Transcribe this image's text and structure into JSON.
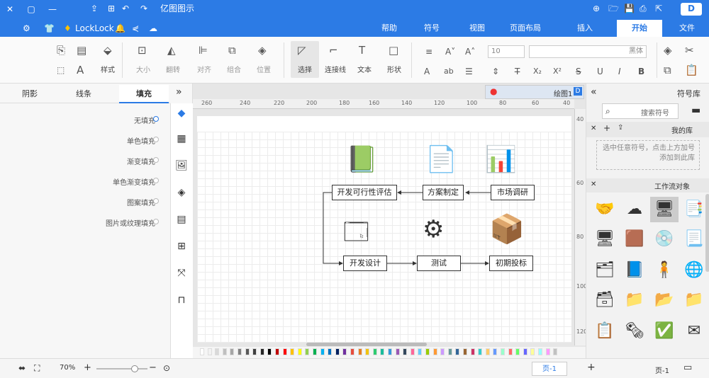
{
  "app": {
    "title": "亿图图示",
    "quick_access": [
      "LockLock",
      "◇"
    ],
    "tabs": [
      "文件",
      "开始",
      "插入",
      "页面布局",
      "视图",
      "符号",
      "帮助"
    ],
    "active_tab": "开始"
  },
  "ribbon": {
    "font_name": "黑体",
    "font_size": "10",
    "labels": {
      "select": "选择",
      "connector": "连接线",
      "text": "文本",
      "shape": "形状",
      "position": "位置",
      "group": "组合",
      "align": "对齐",
      "flip": "翻转",
      "size": "大小",
      "style": "样式"
    }
  },
  "left_panel": {
    "tabs": [
      "填充",
      "线条",
      "阴影"
    ],
    "active_tab": "填充",
    "fill_options": [
      "无填充",
      "单色填充",
      "渐变填充",
      "单色渐变填充",
      "图案填充",
      "图片或纹理填充"
    ],
    "selected_fill": "无填充"
  },
  "canvas": {
    "doc_tab": "绘图1",
    "ruler_ticks": [
      "260",
      "240",
      "220",
      "200",
      "180",
      "160",
      "140",
      "120",
      "100",
      "80",
      "60",
      "40"
    ],
    "vruler_ticks": [
      "40",
      "60",
      "80",
      "100",
      "120"
    ],
    "nodes": {
      "market_research": "市场调研",
      "plan": "方案制定",
      "feasibility": "开发可行性评估",
      "initial_bid": "初期投标",
      "test": "测试",
      "design": "开发设计"
    }
  },
  "library": {
    "title": "符号库",
    "search_placeholder": "搜索符号",
    "my_library": "我的库",
    "my_library_hint": "选中任意符号，点击上方加号添加到此库",
    "category": "工作流对象"
  },
  "status": {
    "page_label": "页-1",
    "page_tab": "页-1",
    "zoom": "70%"
  },
  "palette": [
    "#ffffff",
    "#f2f2f2",
    "#d9d9d9",
    "#bfbfbf",
    "#a6a6a6",
    "#808080",
    "#595959",
    "#404040",
    "#262626",
    "#000000",
    "#c00000",
    "#ff0000",
    "#ffc000",
    "#ffff00",
    "#92d050",
    "#00b050",
    "#00b0f0",
    "#0070c0",
    "#002060",
    "#7030a0",
    "#e74c3c",
    "#e67e22",
    "#f1c40f",
    "#2ecc71",
    "#1abc9c",
    "#3498db",
    "#9b59b6",
    "#34495e",
    "#ff6699",
    "#66ccff",
    "#99cc00",
    "#ff9933",
    "#cc99ff",
    "#669999",
    "#336699",
    "#996633",
    "#cc3366",
    "#33cccc",
    "#ffcc66",
    "#6699ff",
    "#99ffcc",
    "#ff6666",
    "#66ff66",
    "#6666ff",
    "#ffff99",
    "#99ffff",
    "#ff99ff",
    "#c0c0c0"
  ]
}
